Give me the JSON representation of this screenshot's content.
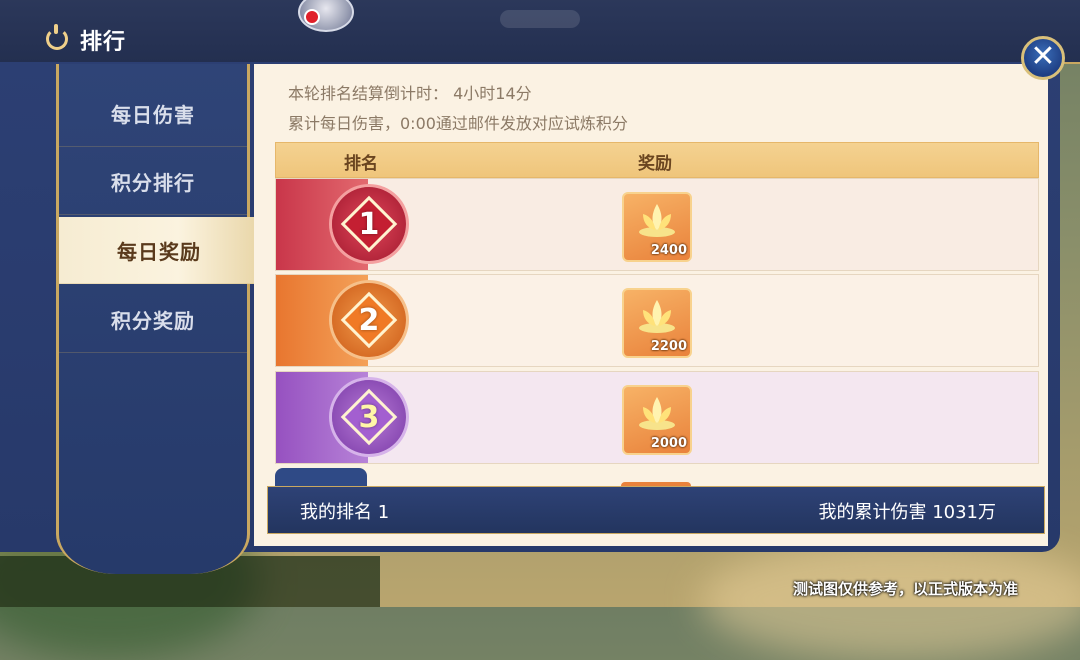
{
  "header": {
    "title": "排行"
  },
  "sidebar": {
    "tabs": [
      {
        "label": "每日伤害"
      },
      {
        "label": "积分排行"
      },
      {
        "label": "每日奖励"
      },
      {
        "label": "积分奖励"
      }
    ],
    "active_index": 2
  },
  "info": {
    "countdown": "本轮排名结算倒计时： 4小时14分",
    "description": "累计每日伤害，0:00通过邮件发放对应试炼积分"
  },
  "table": {
    "headers": {
      "rank": "排名",
      "reward": "奖励"
    },
    "rows": [
      {
        "rank": "1",
        "reward_count": "2400",
        "color": "#d8374f"
      },
      {
        "rank": "2",
        "reward_count": "2200",
        "color": "#f08a3c"
      },
      {
        "rank": "3",
        "reward_count": "2000",
        "color": "#a463c9"
      }
    ]
  },
  "my_bar": {
    "my_rank": "我的排名 1",
    "my_damage": "我的累计伤害 1031万"
  },
  "footer_note": "测试图仅供参考，以正式版本为准",
  "colors": {
    "panel_navy": "#2c3f73",
    "gold_border": "#c9a861",
    "cream": "#fbf2e3",
    "header_gold": "#f4d291"
  }
}
